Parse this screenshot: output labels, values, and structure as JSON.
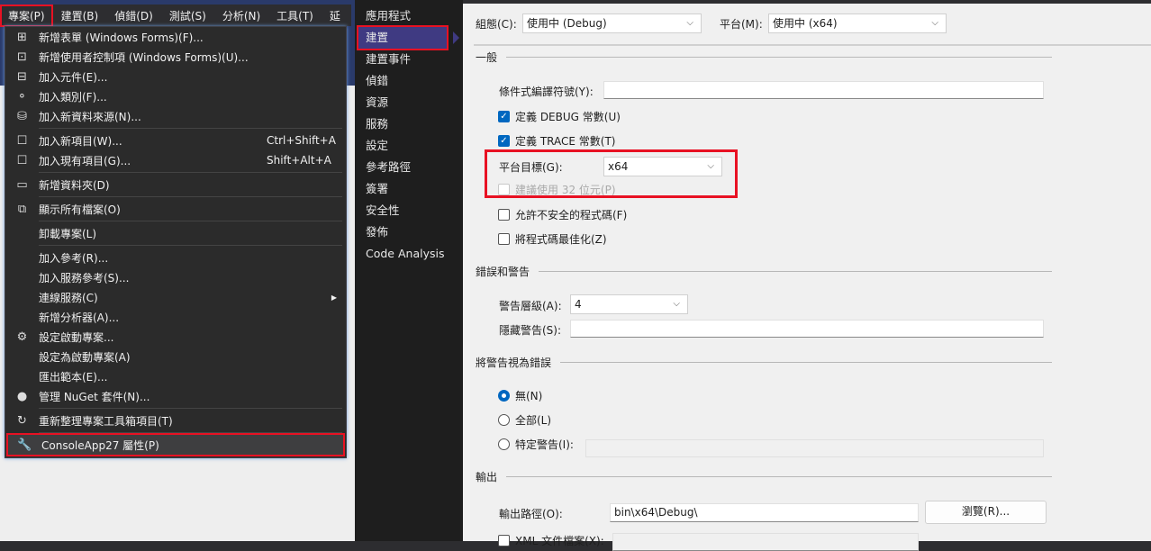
{
  "menubar": {
    "items": [
      "專案(P)",
      "建置(B)",
      "偵錯(D)",
      "測試(S)",
      "分析(N)",
      "工具(T)",
      "延"
    ]
  },
  "menu": {
    "items": [
      {
        "icon": "new-form-icon",
        "glyph": "⊞",
        "label": "新增表單 (Windows Forms)(F)..."
      },
      {
        "icon": "new-user-control-icon",
        "glyph": "⊡",
        "label": "新增使用者控制項 (Windows Forms)(U)..."
      },
      {
        "icon": "add-component-icon",
        "glyph": "⊟",
        "label": "加入元件(E)..."
      },
      {
        "icon": "add-class-icon",
        "glyph": "⚬",
        "label": "加入類別(F)..."
      },
      {
        "icon": "add-data-source-icon",
        "glyph": "⛁",
        "label": "加入新資料來源(N)..."
      },
      {
        "sep": true
      },
      {
        "icon": "add-new-item-icon",
        "glyph": "☐",
        "label": "加入新項目(W)...",
        "shortcut": "Ctrl+Shift+A"
      },
      {
        "icon": "add-existing-item-icon",
        "glyph": "☐",
        "label": "加入現有項目(G)...",
        "shortcut": "Shift+Alt+A"
      },
      {
        "sep": true
      },
      {
        "icon": "new-folder-icon",
        "glyph": "▭",
        "label": "新增資料夾(D)"
      },
      {
        "sep": true
      },
      {
        "icon": "show-all-files-icon",
        "glyph": "⧉",
        "label": "顯示所有檔案(O)"
      },
      {
        "sep": true
      },
      {
        "label": "卸載專案(L)"
      },
      {
        "sep": true
      },
      {
        "label": "加入參考(R)..."
      },
      {
        "label": "加入服務參考(S)..."
      },
      {
        "label": "連線服務(C)",
        "submenu": true
      },
      {
        "label": "新增分析器(A)..."
      },
      {
        "icon": "gear-icon",
        "glyph": "⚙",
        "label": "設定啟動專案..."
      },
      {
        "label": "設定為啟動專案(A)"
      },
      {
        "label": "匯出範本(E)..."
      },
      {
        "icon": "nuget-icon",
        "glyph": "●",
        "label": "管理 NuGet 套件(N)..."
      },
      {
        "sep": true
      },
      {
        "icon": "refresh-icon",
        "glyph": "↻",
        "label": "重新整理專案工具箱項目(T)"
      },
      {
        "sep": true
      },
      {
        "icon": "wrench-icon",
        "glyph": "🔧",
        "label": "ConsoleApp27 屬性(P)",
        "highlighted": true
      }
    ]
  },
  "sidebar": {
    "items": [
      "應用程式",
      "建置",
      "建置事件",
      "偵錯",
      "資源",
      "服務",
      "設定",
      "參考路徑",
      "簽署",
      "安全性",
      "發佈",
      "Code Analysis"
    ],
    "selected": "建置"
  },
  "build": {
    "config_label": "組態(C):",
    "config_value": "使用中 (Debug)",
    "platform_label": "平台(M):",
    "platform_value": "使用中 (x64)",
    "general": "一般",
    "cond_symbols_label": "條件式編譯符號(Y):",
    "cond_symbols_value": "",
    "define_debug": {
      "label": "定義 DEBUG 常數(U)",
      "checked": true
    },
    "define_trace": {
      "label": "定義 TRACE 常數(T)",
      "checked": true
    },
    "platform_target_label": "平台目標(G):",
    "platform_target_value": "x64",
    "prefer32": {
      "label": "建議使用 32 位元(P)",
      "checked": false,
      "disabled": true
    },
    "unsafe": {
      "label": "允許不安全的程式碼(F)",
      "checked": false
    },
    "optimize": {
      "label": "將程式碼最佳化(Z)",
      "checked": false
    },
    "errors_warnings": "錯誤和警告",
    "warning_level_label": "警告層級(A):",
    "warning_level_value": "4",
    "suppress_label": "隱藏警告(S):",
    "suppress_value": "",
    "treat_as_errors": "將警告視為錯誤",
    "radio_none": "無(N)",
    "radio_all": "全部(L)",
    "radio_specific": "特定警告(I):",
    "radio_selected": "無(N)",
    "output": "輸出",
    "output_path_label": "輸出路徑(O):",
    "output_path_value": "bin\\x64\\Debug\\",
    "browse": "瀏覽(R)...",
    "xml_doc": {
      "label": "XML 文件檔案(X):",
      "checked": false
    }
  },
  "colors": {
    "highlight": "#e81123",
    "accent": "#0067c0",
    "sidebar_selected": "#3f3a82"
  }
}
